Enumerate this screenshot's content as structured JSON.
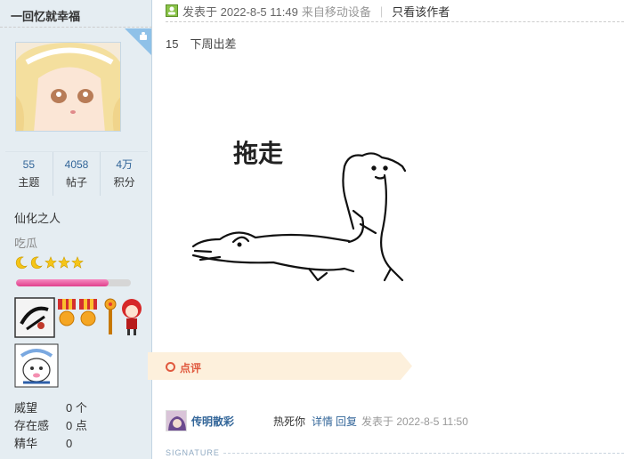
{
  "user": {
    "name": "一回忆就幸福",
    "stats": [
      {
        "num": "55",
        "label": "主题"
      },
      {
        "num": "4058",
        "label": "帖子"
      },
      {
        "num": "4万",
        "label": "积分"
      }
    ],
    "title": "仙化之人",
    "group": "吃瓜",
    "rank_icons": [
      "moon-icon",
      "moon-icon",
      "star-icon",
      "star-icon",
      "star-icon"
    ],
    "progress_fraction": 0.81,
    "info": [
      {
        "key": "威望",
        "value": "0 个"
      },
      {
        "key": "存在感",
        "value": "0 点"
      },
      {
        "key": "精华",
        "value": "0"
      }
    ]
  },
  "post": {
    "posted": "发表于 2022-8-5 11:49",
    "device": "来自移动设备",
    "separator": "|",
    "only_author": "只看该作者",
    "content": "15　下周出差",
    "sticker_text": "拖走"
  },
  "comments": {
    "label": "点评",
    "items": [
      {
        "user": "传明散彩",
        "text": "热死你",
        "detail_link": "详情",
        "reply_link": "回复",
        "time": "发表于 2022-8-5 11:50"
      }
    ]
  },
  "signature": {
    "label": "SIGNATURE"
  },
  "colors": {
    "sidebar_bg": "#e5edf2",
    "link": "#336699",
    "comment_accent": "#e0593e",
    "comment_bg": "#fdf0dc",
    "progress": "#e0408c"
  }
}
